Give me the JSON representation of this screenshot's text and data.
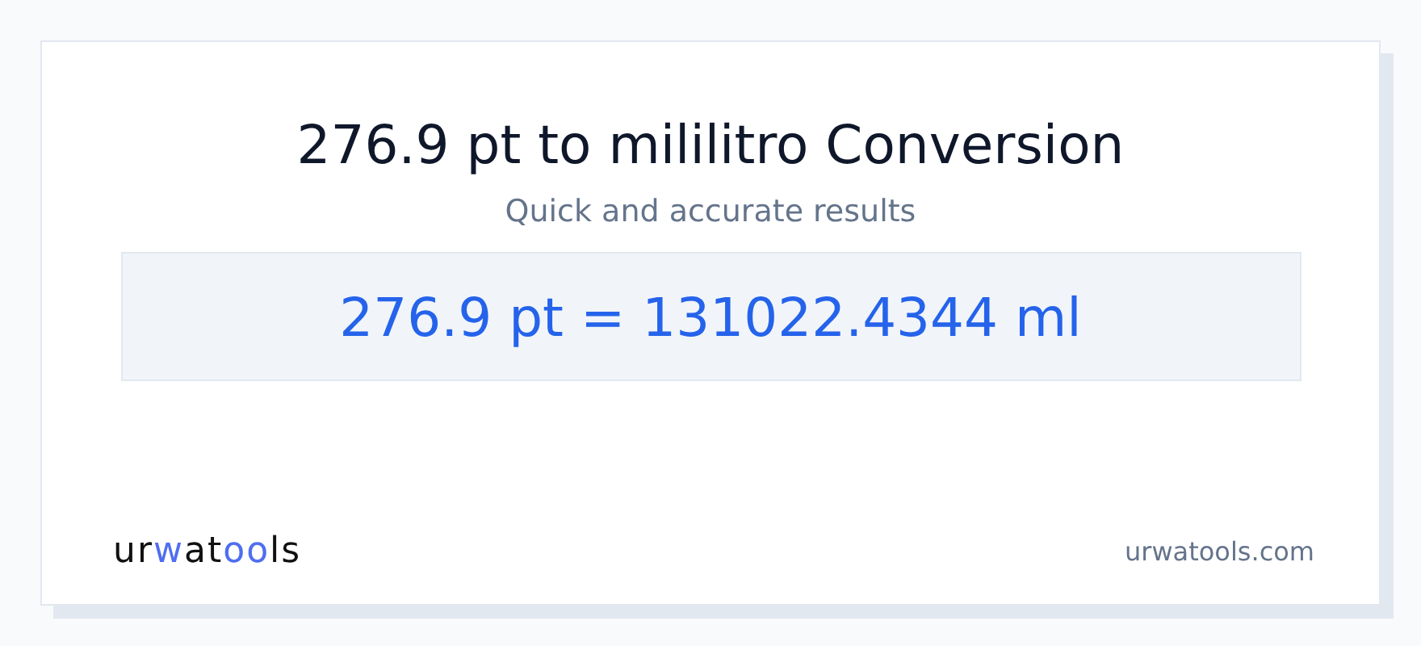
{
  "title": "276.9 pt to mililitro Conversion",
  "subtitle": "Quick and accurate results",
  "result": "276.9 pt = 131022.4344 ml",
  "logo": [
    {
      "text": "ur",
      "accent": false
    },
    {
      "text": "w",
      "accent": true
    },
    {
      "text": "at",
      "accent": false
    },
    {
      "text": "oo",
      "accent": true
    },
    {
      "text": "ls",
      "accent": false
    }
  ],
  "site": "urwatools.com"
}
